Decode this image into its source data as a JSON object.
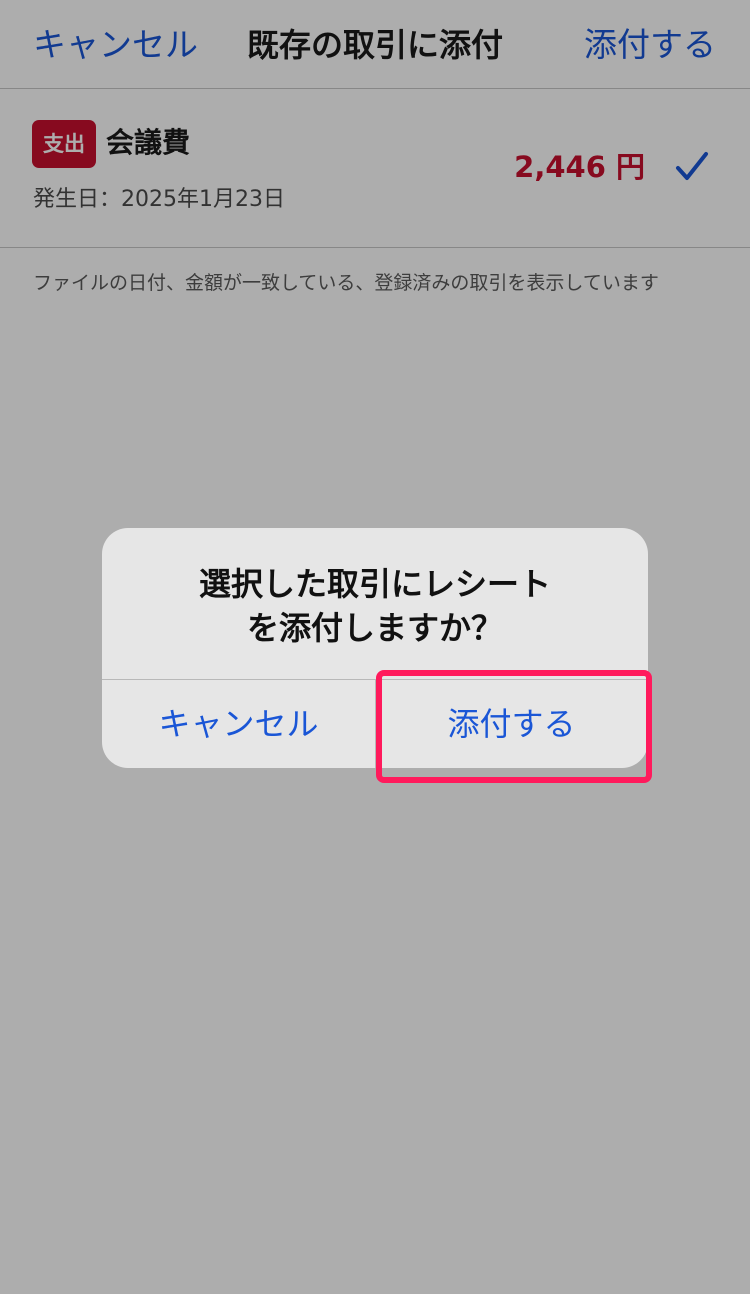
{
  "nav": {
    "cancel_label": "キャンセル",
    "title": "既存の取引に添付",
    "attach_label": "添付する"
  },
  "transaction": {
    "type_badge": "支出",
    "category": "会議費",
    "date": "発生日：2025年1月23日",
    "amount": "2,446 円",
    "selected": true
  },
  "note": "ファイルの日付、金額が一致している、登録済みの取引を表示しています",
  "alert": {
    "title_line1": "選択した取引にレシート",
    "title_line2": "を添付しますか？",
    "cancel_label": "キャンセル",
    "confirm_label": "添付する"
  },
  "colors": {
    "accent": "#1a56d6",
    "expense": "#c8102e",
    "highlight": "#ff1a5c"
  },
  "icons": {
    "selected": "checkmark-icon"
  }
}
